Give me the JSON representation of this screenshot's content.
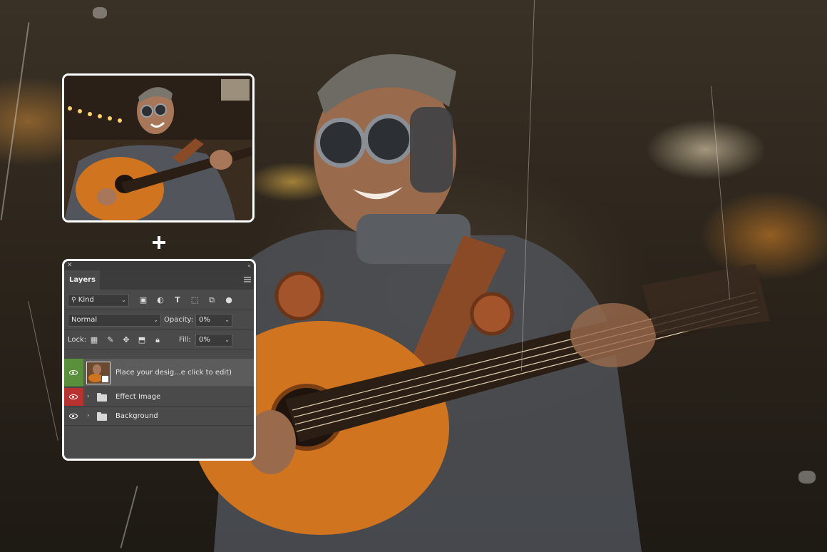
{
  "panel": {
    "title": "Layers",
    "filter": {
      "label": "Kind"
    },
    "blend_mode": "Normal",
    "opacity": {
      "label": "Opacity:",
      "value": "0%"
    },
    "lock_label": "Lock:",
    "fill": {
      "label": "Fill:",
      "value": "0%"
    },
    "layers": [
      {
        "name": "Place your desig...e click to edit)",
        "type": "smart-object",
        "selected": true,
        "eye_color": "#5a8f3c"
      },
      {
        "name": "Effect Image",
        "type": "group",
        "eye_color": "#b83232"
      },
      {
        "name": "Background",
        "type": "group",
        "eye_color": "#4a4a4a"
      }
    ],
    "filter_icons": [
      "image-filter-icon",
      "adjustment-filter-icon",
      "type-filter-icon",
      "shape-filter-icon",
      "smart-object-filter-icon",
      "filter-toggle-icon"
    ],
    "lock_icons": [
      "lock-transparent-icon",
      "lock-image-icon",
      "lock-position-icon",
      "lock-artboard-icon",
      "lock-all-icon"
    ]
  },
  "colors": {
    "panel_bg": "#4a4a4a",
    "selected_row": "#5c5c5c",
    "card_border": "#ffffff"
  }
}
